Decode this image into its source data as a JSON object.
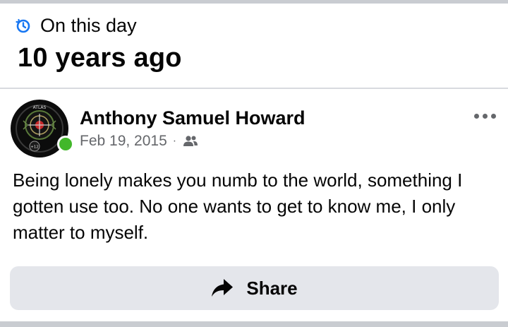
{
  "memory": {
    "label": "On this day",
    "title": "10 years ago",
    "icon": "memories-clock-icon"
  },
  "post": {
    "author": "Anthony Samuel Howard",
    "date": "Feb 19, 2015",
    "separator": "·",
    "audience_icon": "friends-icon",
    "online": true,
    "text": "Being lonely makes you numb to the world, something I gotten use too. No one wants to get to know me, I only matter to myself.",
    "avatar_text": {
      "top": "ATLAS",
      "badge": "+12"
    }
  },
  "actions": {
    "share_label": "Share",
    "share_icon": "share-arrow-icon",
    "more_icon": "more-options-icon"
  },
  "colors": {
    "accent": "#1877f2",
    "secondary_text": "#65676b",
    "button_bg": "#e4e6eb",
    "online": "#42b72a",
    "divider": "#c9ccd1"
  }
}
